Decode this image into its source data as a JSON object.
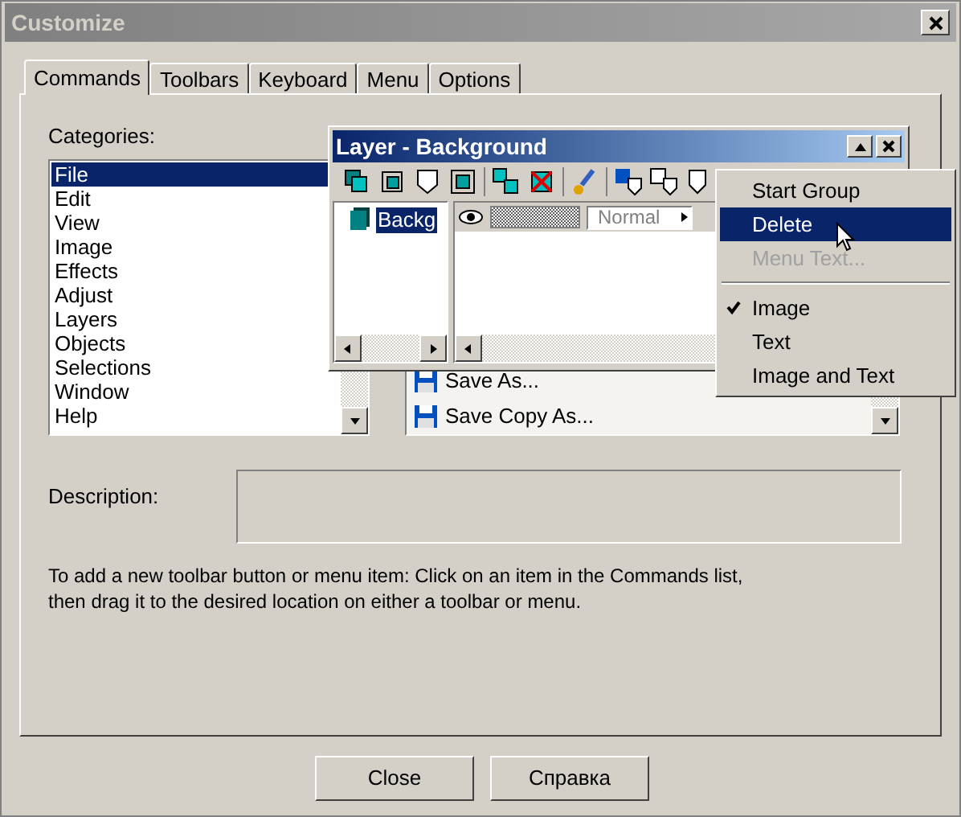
{
  "window": {
    "title": "Customize"
  },
  "tabs": [
    {
      "label": "Commands",
      "selected": true
    },
    {
      "label": "Toolbars",
      "selected": false
    },
    {
      "label": "Keyboard",
      "selected": false
    },
    {
      "label": "Menu",
      "selected": false
    },
    {
      "label": "Options",
      "selected": false
    }
  ],
  "categories": {
    "label": "Categories:",
    "items": [
      {
        "label": "File",
        "selected": true
      },
      {
        "label": "Edit",
        "selected": false
      },
      {
        "label": "View",
        "selected": false
      },
      {
        "label": "Image",
        "selected": false
      },
      {
        "label": "Effects",
        "selected": false
      },
      {
        "label": "Adjust",
        "selected": false
      },
      {
        "label": "Layers",
        "selected": false
      },
      {
        "label": "Objects",
        "selected": false
      },
      {
        "label": "Selections",
        "selected": false
      },
      {
        "label": "Window",
        "selected": false
      },
      {
        "label": "Help",
        "selected": false
      }
    ]
  },
  "commands": {
    "items": [
      {
        "label": "Save As..."
      },
      {
        "label": "Save Copy As..."
      }
    ]
  },
  "description": {
    "label": "Description:"
  },
  "hint": "To add a new toolbar button or menu item:  Click on an item in the Commands list,\nthen drag it to the desired location on either a toolbar or menu.",
  "buttons": [
    "Close",
    "Справка"
  ],
  "layer_palette": {
    "title": "Layer - Background",
    "layer_name": "Backg",
    "blend_mode": "Normal",
    "opacity": {
      "level": 1
    }
  },
  "context_menu": {
    "items": [
      {
        "kind": "item",
        "label": "Start Group",
        "selected": false,
        "disabled": false,
        "checked": false
      },
      {
        "kind": "item",
        "label": "Delete",
        "selected": true,
        "disabled": false,
        "checked": false
      },
      {
        "kind": "item",
        "label": "Menu Text...",
        "selected": false,
        "disabled": true,
        "checked": false
      },
      {
        "kind": "separator"
      },
      {
        "kind": "item",
        "label": "Image",
        "selected": false,
        "disabled": false,
        "checked": true
      },
      {
        "kind": "item",
        "label": "Text",
        "selected": false,
        "disabled": false,
        "checked": false
      },
      {
        "kind": "item",
        "label": "Image and Text",
        "selected": false,
        "disabled": false,
        "checked": false
      }
    ]
  }
}
